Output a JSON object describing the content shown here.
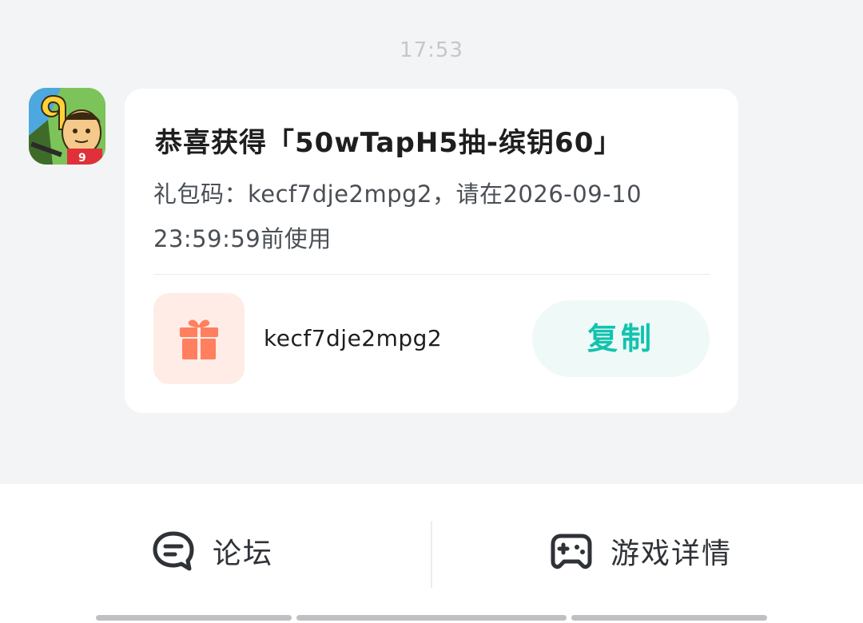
{
  "time": "17:53",
  "app_icon": "game-app-icon",
  "card": {
    "title": "恭喜获得「50wTapH5抽-缤钥60」",
    "desc": "礼包码：kecf7dje2mpg2，请在2026-09-10 23:59:59前使用",
    "gift_icon": "gift-icon",
    "code": "kecf7dje2mpg2",
    "copy_label": "复制"
  },
  "bottom": {
    "forum_icon": "chat-bubble-icon",
    "forum_label": "论坛",
    "game_icon": "gamepad-icon",
    "game_label": "游戏详情"
  },
  "colors": {
    "accent": "#12c3ae",
    "gift_icon": "#ff7f5e",
    "gift_bg": "#ffece6",
    "copy_bg": "#effaf8",
    "page_bg": "#f3f4f6"
  }
}
